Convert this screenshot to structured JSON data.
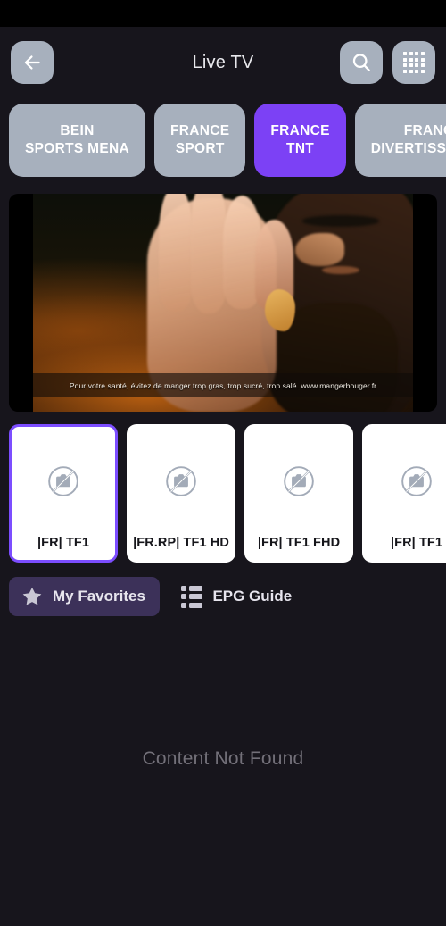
{
  "app": {
    "background_color": "#17151c",
    "accent_color": "#7c41f5",
    "selected_border_color": "#7c4dff"
  },
  "header": {
    "title": "Live TV",
    "back_icon": "arrow-left-icon",
    "search_icon": "search-icon",
    "grid_icon": "grid-icon"
  },
  "categories": [
    {
      "label": "BEIN\nSPORTS MENA",
      "active": false
    },
    {
      "label": "FRANCE\nSPORT",
      "active": false
    },
    {
      "label": "FRANCE\nTNT",
      "active": true
    },
    {
      "label": "FRANCE\nDIVERTISSEMENT",
      "active": false
    }
  ],
  "player": {
    "disclaimer": "Pour votre santé, évitez de manger trop gras, trop sucré, trop salé. www.mangerbouger.fr"
  },
  "channels": [
    {
      "label": "|FR| TF1",
      "selected": true,
      "thumb_icon": "broken-image-icon"
    },
    {
      "label": "|FR.RP| TF1 HD",
      "selected": false,
      "thumb_icon": "broken-image-icon"
    },
    {
      "label": "|FR| TF1 FHD",
      "selected": false,
      "thumb_icon": "broken-image-icon"
    },
    {
      "label": "|FR| TF1",
      "selected": false,
      "thumb_icon": "broken-image-icon"
    }
  ],
  "actions": {
    "favorites_label": "My Favorites",
    "favorites_icon": "star-icon",
    "epg_label": "EPG Guide",
    "epg_icon": "list-icon"
  },
  "empty_state": {
    "message": "Content Not Found"
  }
}
